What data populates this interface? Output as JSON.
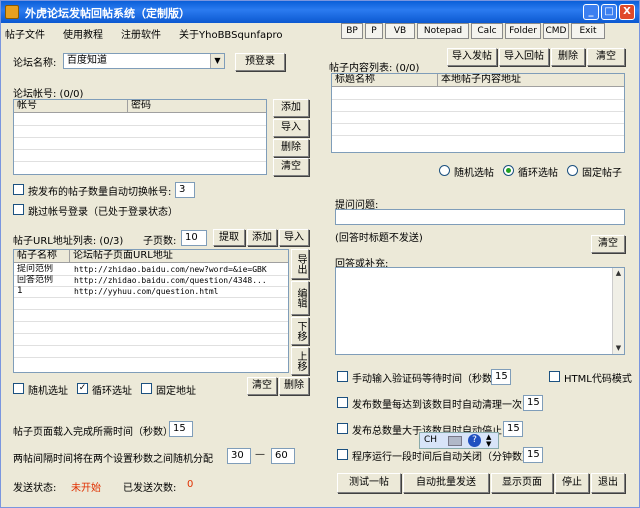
{
  "window": {
    "title": "外虎论坛发帖回帖系统（定制版）",
    "min": "_",
    "max": "□",
    "close": "X"
  },
  "menu": [
    "帖子文件",
    "使用教程",
    "注册软件",
    "关于YhoBBSqunfapro"
  ],
  "toolbar": [
    "BP",
    "P",
    "VB",
    "Notepad",
    "Calc",
    "Folder",
    "CMD",
    "Exit"
  ],
  "forum": {
    "label": "论坛名称:",
    "value": "百度知道",
    "prelogin": "预登录"
  },
  "accounts": {
    "label": "论坛帐号: (0/0)",
    "headers": [
      "帐号",
      "密码"
    ],
    "buttons": [
      "添加",
      "导入",
      "删除",
      "清空"
    ]
  },
  "options": {
    "auto_switch": "按发布的帖子数量自动切换帐号:",
    "auto_switch_value": "3",
    "skip_login": "跳过帐号登录（已处于登录状态）"
  },
  "urls": {
    "label": "帖子URL地址列表: (0/3)",
    "subpage_label": "子页数:",
    "subpage_value": "10",
    "buttons": [
      "提取",
      "添加",
      "导入"
    ],
    "headers": [
      "帖子名称",
      "论坛帖子页面URL地址"
    ],
    "rows": [
      {
        "name": "提问范例",
        "url": "http://zhidao.baidu.com/new?word=&ie=GBK"
      },
      {
        "name": "回答范例",
        "url": "http://zhidao.baidu.com/question/4348..."
      },
      {
        "name": "1",
        "url": "http://yyhuu.com/question.html"
      }
    ],
    "side": [
      "导出",
      "编辑",
      "下移",
      "上移"
    ],
    "radios": [
      "随机选址",
      "循环选址",
      "固定地址"
    ],
    "bottom_buttons": [
      "清空",
      "删除"
    ]
  },
  "timing": {
    "load_label": "帖子页面载入完成所需时间（秒数）",
    "load_value": "15",
    "interval_label": "两帖间隔时间将在两个设置秒数之间随机分配",
    "interval_min": "30",
    "dash": "—",
    "interval_max": "60"
  },
  "status": {
    "label": "发送状态:",
    "value": "未开始",
    "count_label": "已发送次数:",
    "count_value": "0"
  },
  "content": {
    "label": "帖子内容列表: (0/0)",
    "buttons": [
      "导入发帖",
      "导入回帖",
      "删除",
      "清空"
    ],
    "headers": [
      "标题名称",
      "本地帖子内容地址"
    ],
    "radios": [
      "随机选帖",
      "循环选帖",
      "固定帖子"
    ]
  },
  "question": {
    "label": "提问问题:",
    "note": "(回答时标题不发送)",
    "clear": "清空"
  },
  "answer": {
    "label": "回答或补充:"
  },
  "right_options": {
    "captcha": "手动输入验证码等待时间（秒数）",
    "captcha_value": "15",
    "html_mode": "HTML代码模式",
    "clear_after": "发布数量每达到该数目时自动清理一次",
    "clear_after_value": "15",
    "stop_after": "发布总数量大于该数目时自动停止",
    "stop_after_value": "15",
    "close_after": "程序运行一段时间后自动关闭（分钟数）",
    "close_after_value": "15"
  },
  "ime": {
    "ch": "CH"
  },
  "actions": [
    "测试一帖",
    "自动批量发送",
    "显示页面",
    "停止",
    "退出"
  ],
  "colors": {
    "status_value": "#e03000",
    "title_blue": "#0a5fd8"
  }
}
